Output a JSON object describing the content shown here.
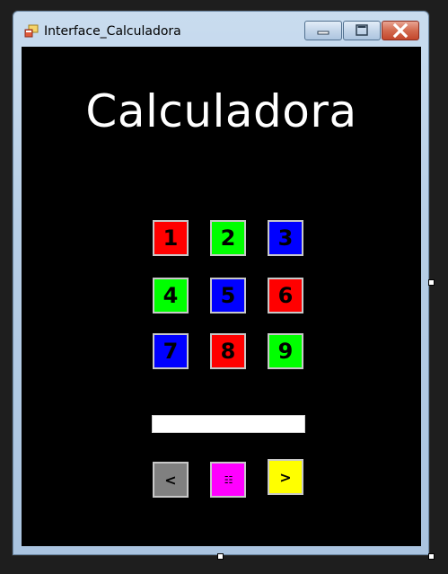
{
  "window": {
    "title": "Interface_Calculadora"
  },
  "icons": {
    "app": "app-form-icon",
    "minimize": "minimize-icon",
    "maximize": "maximize-icon",
    "close": "close-icon"
  },
  "heading": "Calculadora",
  "keypad": [
    {
      "label": "1",
      "color": "#ff0000"
    },
    {
      "label": "2",
      "color": "#00ff00"
    },
    {
      "label": "3",
      "color": "#0000ff"
    },
    {
      "label": "4",
      "color": "#00ff00"
    },
    {
      "label": "5",
      "color": "#0000ff"
    },
    {
      "label": "6",
      "color": "#ff0000"
    },
    {
      "label": "7",
      "color": "#0000ff"
    },
    {
      "label": "8",
      "color": "#ff0000"
    },
    {
      "label": "9",
      "color": "#00ff00"
    }
  ],
  "display": {
    "value": ""
  },
  "controls": [
    {
      "label": "<",
      "color": "#808080"
    },
    {
      "label": "☷",
      "color": "#ff00ff"
    },
    {
      "label": ">",
      "color": "#ffff00"
    }
  ]
}
